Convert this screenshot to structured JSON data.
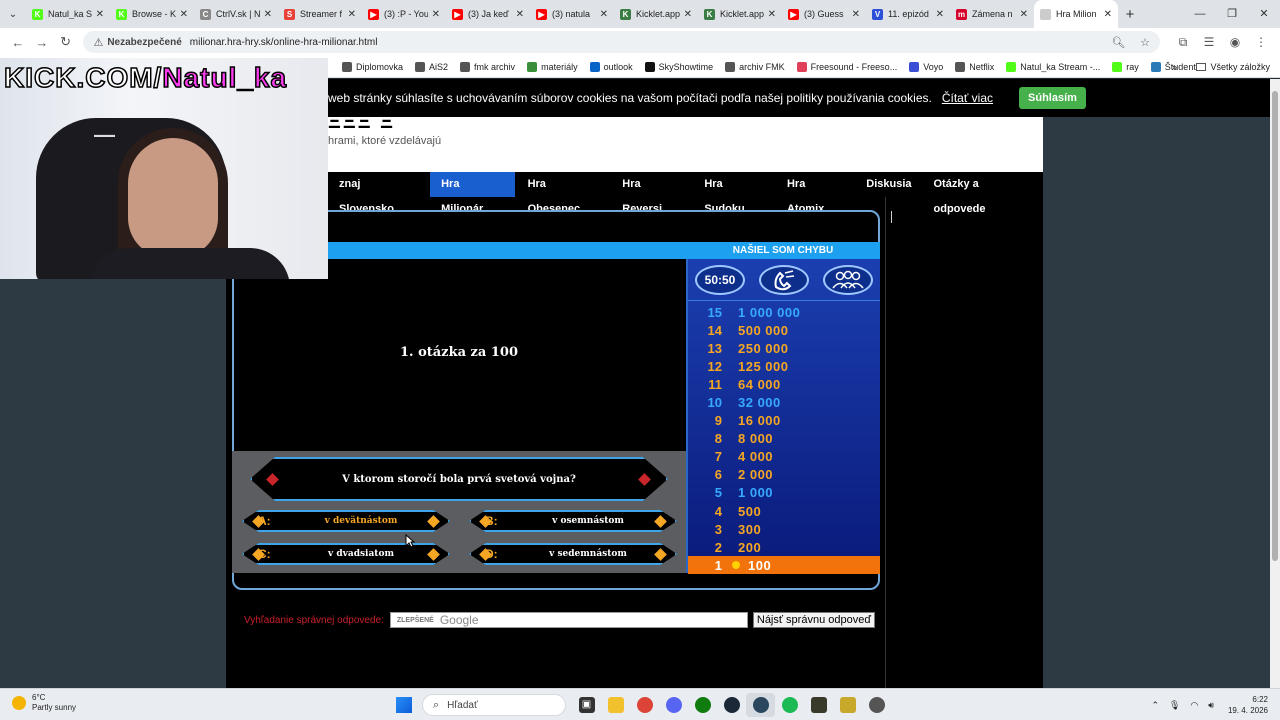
{
  "browser": {
    "tabs": [
      {
        "title": "Natul_ka S",
        "fav": "K",
        "color": "#53fc18"
      },
      {
        "title": "Browse - K",
        "fav": "K",
        "color": "#53fc18"
      },
      {
        "title": "CtrlV.sk | N",
        "fav": "C",
        "color": "#888888"
      },
      {
        "title": "Streamer f",
        "fav": "S",
        "color": "#e8413a"
      },
      {
        "title": "(3) :P - You",
        "fav": "▶",
        "color": "#ff0000"
      },
      {
        "title": "(3) Ja keď",
        "fav": "▶",
        "color": "#ff0000"
      },
      {
        "title": "(3) natula",
        "fav": "▶",
        "color": "#ff0000"
      },
      {
        "title": "Kicklet.app",
        "fav": "K",
        "color": "#3a7d44"
      },
      {
        "title": "Kicklet.app",
        "fav": "K",
        "color": "#3a7d44"
      },
      {
        "title": "(3) Guess",
        "fav": "▶",
        "color": "#ff0000"
      },
      {
        "title": "11. epizód",
        "fav": "V",
        "color": "#2b4fd6"
      },
      {
        "title": "Zámena n",
        "fav": "m",
        "color": "#d6002a"
      },
      {
        "title": "Hra Milion",
        "fav": "",
        "color": "#cccccc"
      }
    ],
    "security_label": "Nezabezpečené",
    "url": "milionar.hra-hry.sk/online-hra-milionar.html",
    "bookmarks": [
      {
        "label": "Diplomovka",
        "color": "#555555"
      },
      {
        "label": "AiS2",
        "color": "#555555"
      },
      {
        "label": "fmk archiv",
        "color": "#555555"
      },
      {
        "label": "materiály",
        "color": "#3b8f3b"
      },
      {
        "label": "outlook",
        "color": "#0a64c8"
      },
      {
        "label": "SkyShowtime",
        "color": "#111111"
      },
      {
        "label": "archiv FMK",
        "color": "#555555"
      },
      {
        "label": "Freesound - Freeso...",
        "color": "#e0405a"
      },
      {
        "label": "Voyo",
        "color": "#3a4fd6"
      },
      {
        "label": "Netflix",
        "color": "#555555"
      },
      {
        "label": "Natul_ka Stream -...",
        "color": "#53fc18"
      },
      {
        "label": "ray",
        "color": "#53fc18"
      },
      {
        "label": "Študent",
        "color": "#2a7ab8"
      }
    ],
    "all_bookmarks": "Všetky záložky"
  },
  "webcam": {
    "prefix": "KICK.COM/",
    "name": "Natul_ka"
  },
  "site": {
    "cookie_text": "web stránky súhlasíte s uchovávaním súborov cookies na vašom počítači podľa našej politiky používania cookies.",
    "cookie_link": "Čítať viac",
    "cookie_button": "Súhlasím",
    "logo_fragment": "ΞΞΞ Ξ",
    "tagline": "hrami, ktoré vzdelávajú",
    "nav": [
      {
        "label": "znaj Slovensko",
        "active": false
      },
      {
        "label": "Hra Milionár",
        "active": true
      },
      {
        "label": "Hra Obesenec",
        "active": false
      },
      {
        "label": "Hra Reversi",
        "active": false
      },
      {
        "label": "Hra Sudoku",
        "active": false
      },
      {
        "label": "Hra Atomix",
        "active": false
      },
      {
        "label": "Diskusia",
        "active": false
      },
      {
        "label": "Otázky a odpovede",
        "active": false
      }
    ],
    "search_label": "Vyhľadanie správnej odpovede:",
    "search_placeholder": "ZLEPŠENÉ",
    "search_brand": "Google",
    "search_button": "Nájsť správnu odpoveď"
  },
  "game": {
    "report_button": "NAŠIEL SOM CHYBU",
    "lifelines": [
      "50:50",
      "phone-icon",
      "audience-icon"
    ],
    "lifeline_5050": "50:50",
    "question_number": "1. otázka za 100",
    "question": "V ktorom storočí bola prvá svetová vojna?",
    "answers": [
      {
        "letter": "A:",
        "text": "v devätnástom",
        "highlight": true
      },
      {
        "letter": "B:",
        "text": "v osemnástom",
        "highlight": false
      },
      {
        "letter": "C:",
        "text": "v dvadsiatom",
        "highlight": false
      },
      {
        "letter": "D:",
        "text": "v sedemnástom",
        "highlight": false
      }
    ],
    "prizes": [
      {
        "level": "15",
        "amount": "1 000 000",
        "milestone": true
      },
      {
        "level": "14",
        "amount": "500 000",
        "milestone": false
      },
      {
        "level": "13",
        "amount": "250 000",
        "milestone": false
      },
      {
        "level": "12",
        "amount": "125 000",
        "milestone": false
      },
      {
        "level": "11",
        "amount": "64 000",
        "milestone": false
      },
      {
        "level": "10",
        "amount": "32 000",
        "milestone": true
      },
      {
        "level": "9",
        "amount": "16 000",
        "milestone": false
      },
      {
        "level": "8",
        "amount": "8 000",
        "milestone": false
      },
      {
        "level": "7",
        "amount": "4 000",
        "milestone": false
      },
      {
        "level": "6",
        "amount": "2 000",
        "milestone": false
      },
      {
        "level": "5",
        "amount": "1 000",
        "milestone": true
      },
      {
        "level": "4",
        "amount": "500",
        "milestone": false
      },
      {
        "level": "3",
        "amount": "300",
        "milestone": false
      },
      {
        "level": "2",
        "amount": "200",
        "milestone": false
      },
      {
        "level": "1",
        "amount": "100",
        "milestone": false,
        "current": true
      }
    ]
  },
  "taskbar": {
    "temperature": "6°C",
    "weather": "Partly sunny",
    "search_placeholder": "Hľadať",
    "time": "6:22",
    "date": "19. 4. 2026"
  }
}
